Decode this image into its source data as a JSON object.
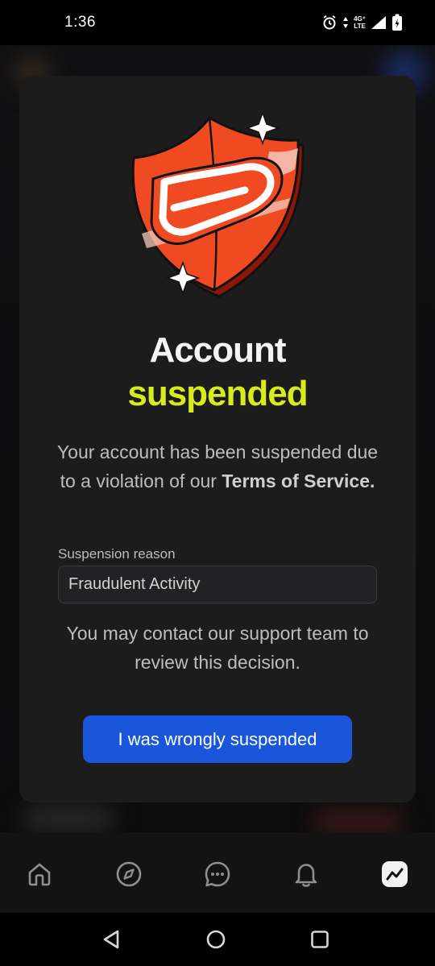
{
  "status_bar": {
    "time": "1:36",
    "network_type_top": "4G⁺",
    "network_type_bottom": "LTE",
    "icons": [
      "alarm-icon",
      "data-arrows-icon",
      "signal-icon",
      "battery-charging-icon"
    ]
  },
  "modal": {
    "illustration": "shield-logo-illustration",
    "title_line1": "Account",
    "title_line2": "suspended",
    "description_prefix": "Your account has been suspended due to a violation of our ",
    "description_bold": "Terms of Service.",
    "reason_label": "Suspension reason",
    "reason_value": "Fraudulent Activity",
    "contact_text": "You may contact our support team to review this decision.",
    "appeal_button": "I was wrongly suspended"
  },
  "tab_bar": {
    "tabs": [
      {
        "icon": "home-icon",
        "active": false
      },
      {
        "icon": "compass-icon",
        "active": false
      },
      {
        "icon": "chat-icon",
        "active": false
      },
      {
        "icon": "bell-icon",
        "active": false
      },
      {
        "icon": "trending-icon",
        "active": true
      }
    ]
  },
  "nav_bar": {
    "buttons": [
      "back-icon",
      "home-circle-icon",
      "recents-icon"
    ]
  },
  "colors": {
    "accent_yellow": "#d8ec1d",
    "button_blue": "#1a56db",
    "shield_red": "#f04a23",
    "modal_bg": "#1c1c1d"
  }
}
